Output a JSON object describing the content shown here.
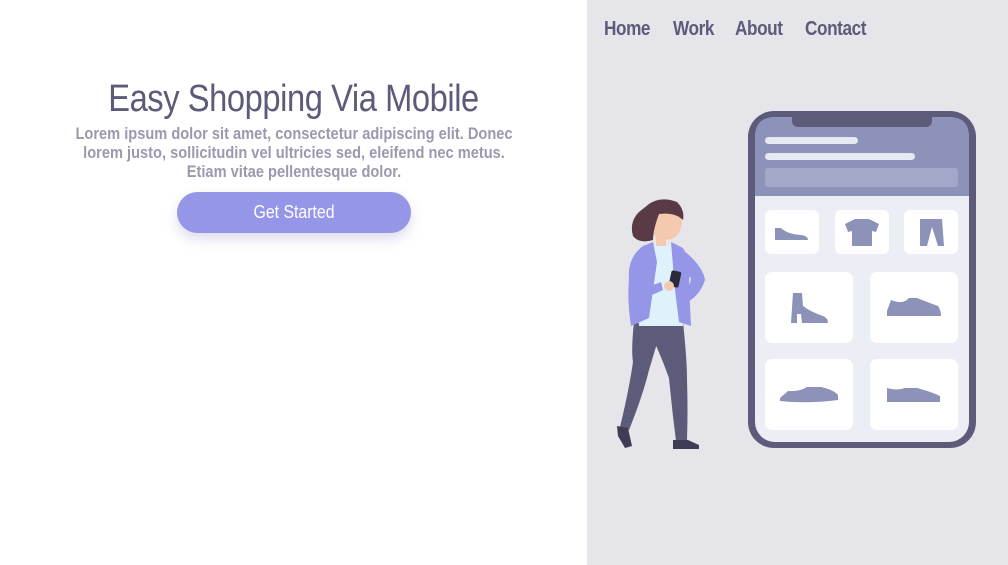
{
  "nav": {
    "items": [
      {
        "label": "Home"
      },
      {
        "label": "Work"
      },
      {
        "label": "About"
      },
      {
        "label": "Contact"
      }
    ]
  },
  "hero": {
    "title": "Easy Shopping Via Mobile",
    "line1": "Lorem ipsum dolor sit amet, consectetur adipiscing elit. Donec",
    "line2": "lorem justo, sollicitudin vel ultricies sed, eleifend nec metus.",
    "line3": "Etiam vitae pellentesque dolor.",
    "cta_label": "Get Started"
  },
  "illustration": {
    "subject": "woman-with-phone",
    "phone_items": [
      "flat-shoe-icon",
      "tshirt-icon",
      "pants-icon",
      "boot-icon",
      "sneaker-icon",
      "loafer-icon",
      "low-shoe-icon"
    ]
  },
  "colors": {
    "panel": "#e6e5ea",
    "text_primary": "#5c5b7a",
    "text_secondary": "#9a99ad",
    "accent": "#9596e8",
    "phone_frame": "#5c5b7a",
    "phone_header": "#8d93b8"
  }
}
